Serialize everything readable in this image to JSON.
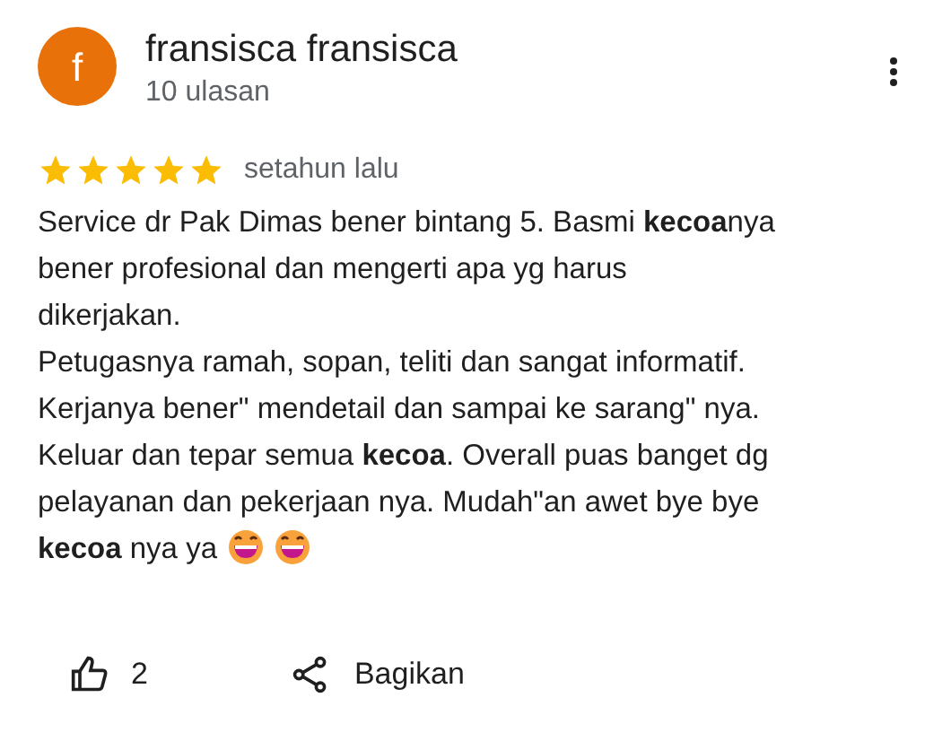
{
  "reviewer": {
    "initial": "f",
    "name": "fransisca fransisca",
    "reviews": "10 ulasan"
  },
  "stars": 5,
  "time": "setahun lalu",
  "lines": [
    "Service dr Pak Dimas bener bintang 5. Basmi **kecoa**nya",
    "bener profesional dan mengerti apa yg harus",
    "dikerjakan.",
    "Petugasnya ramah, sopan, teliti dan sangat informatif.",
    "Kerjanya bener\" mendetail dan sampai ke sarang\" nya.",
    "Keluar dan tepar semua **kecoa**. Overall puas banget dg",
    "pelayanan dan pekerjaan nya. Mudah\"an awet bye bye",
    "**kecoa** nya ya"
  ],
  "likes": "2",
  "share": "Bagikan"
}
